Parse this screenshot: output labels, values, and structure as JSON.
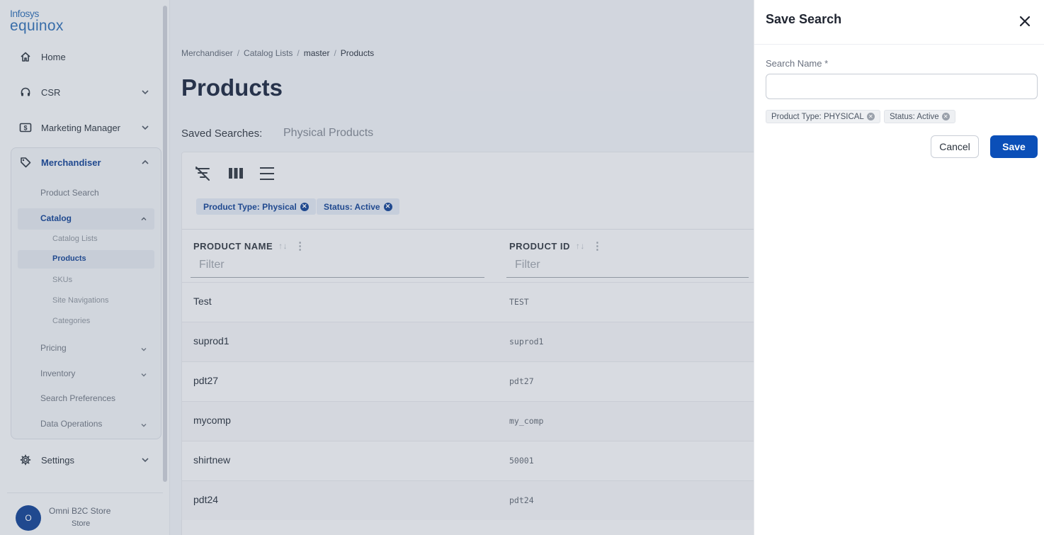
{
  "brand": {
    "line1": "Infosys",
    "line2": "equinox",
    "color": "#2a6bb3"
  },
  "sidebar": {
    "nav": [
      {
        "label": "Home",
        "icon": "home-icon"
      },
      {
        "label": "CSR",
        "icon": "headset-icon"
      },
      {
        "label": "Marketing Manager",
        "icon": "dollar-icon"
      },
      {
        "label": "Merchandiser",
        "icon": "tag-icon"
      },
      {
        "label": "Settings",
        "icon": "gear-icon"
      }
    ],
    "merchandiser": {
      "product_search": "Product Search",
      "catalog": "Catalog",
      "catalog_children": [
        "Catalog Lists",
        "Products",
        "SKUs",
        "Site Navigations",
        "Categories"
      ],
      "pricing": "Pricing",
      "inventory": "Inventory",
      "search_preferences": "Search Preferences",
      "data_operations": "Data Operations"
    },
    "store": {
      "avatar": "O",
      "name": "Omni B2C Store",
      "type": "Store"
    }
  },
  "main": {
    "breadcrumb": [
      "Merchandiser",
      "Catalog Lists",
      "master",
      "Products"
    ],
    "title": "Products",
    "saved_searches_label": "Saved Searches:",
    "saved_search_link": "Physical Products",
    "chips": [
      "Product Type: Physical",
      "Status: Active"
    ],
    "columns": [
      {
        "label": "PRODUCT NAME",
        "filter_placeholder": "Filter"
      },
      {
        "label": "PRODUCT ID",
        "filter_placeholder": "Filter"
      }
    ],
    "rows": [
      {
        "name": "Test",
        "id": "TEST"
      },
      {
        "name": "suprod1",
        "id": "suprod1"
      },
      {
        "name": "pdt27",
        "id": "pdt27"
      },
      {
        "name": "mycomp",
        "id": "my_comp"
      },
      {
        "name": "shirtnew",
        "id": "50001"
      },
      {
        "name": "pdt24",
        "id": "pdt24"
      }
    ]
  },
  "drawer": {
    "title": "Save Search",
    "field_label": "Search Name",
    "required_mark": "*",
    "input_value": "",
    "chips": [
      "Product Type: PHYSICAL",
      "Status: Active"
    ],
    "cancel_label": "Cancel",
    "save_label": "Save",
    "accent": "#0b4fb8"
  }
}
